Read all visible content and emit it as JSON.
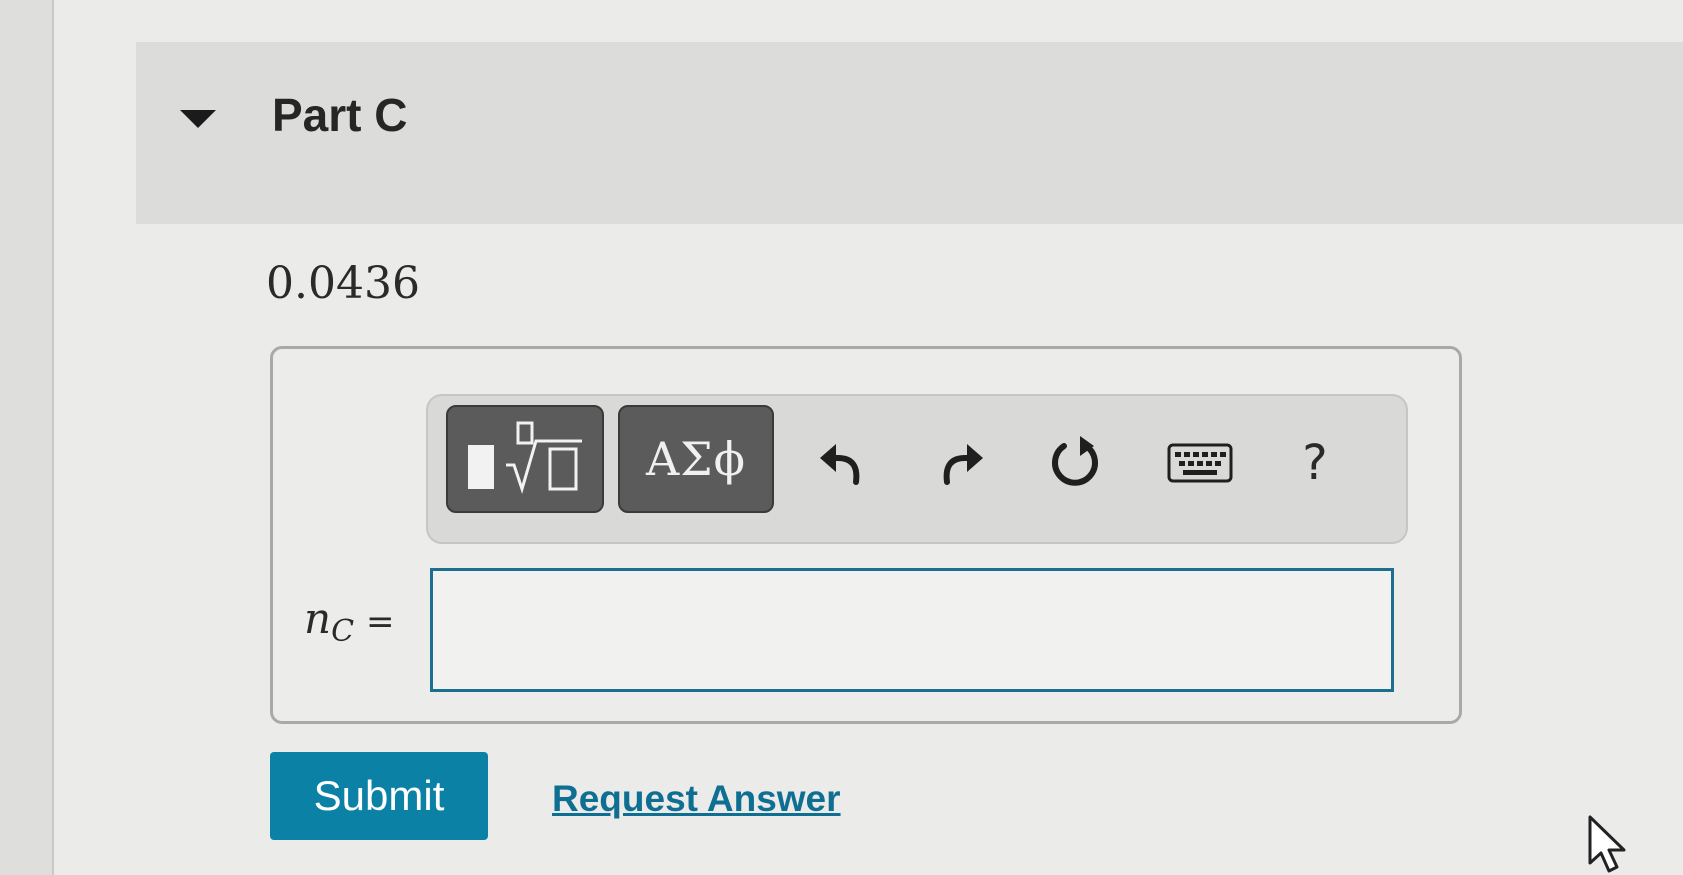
{
  "part": {
    "title": "Part C",
    "collapse_icon": "caret-down-icon"
  },
  "given_value": "0.0436",
  "toolbar": {
    "templates_icon": "templates-radical-icon",
    "symbols_label": "ΑΣϕ",
    "undo_icon": "undo-icon",
    "redo_icon": "redo-icon",
    "reset_icon": "reset-icon",
    "keyboard_icon": "keyboard-icon",
    "help_label": "?"
  },
  "answer": {
    "variable": "n",
    "subscript": "C",
    "equals": "=",
    "value": ""
  },
  "actions": {
    "submit_label": "Submit",
    "request_answer_label": "Request Answer"
  },
  "colors": {
    "accent": "#0b81a6",
    "link": "#0e6f92",
    "input_border": "#1d6f8f",
    "toolbar_button": "#5b5b5b"
  }
}
